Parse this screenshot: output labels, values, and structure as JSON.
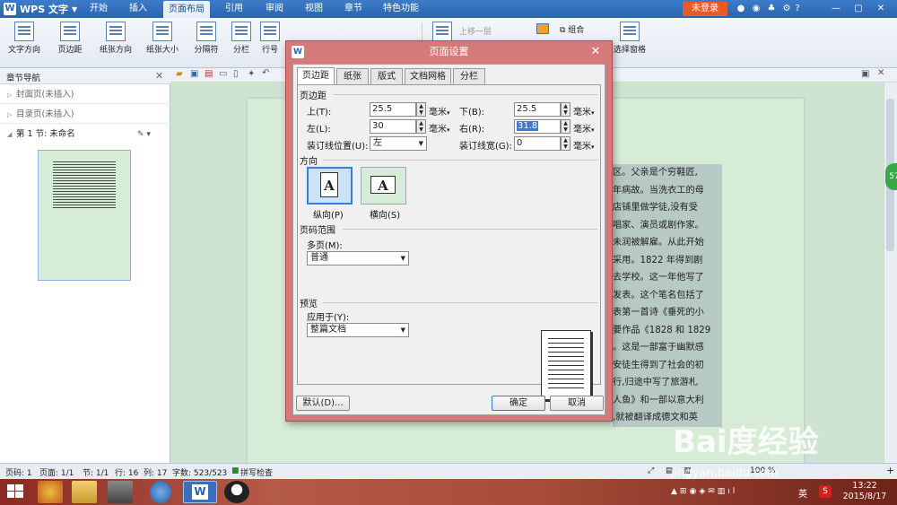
{
  "app": {
    "logo": "WPS 文字",
    "logo_letter": "W",
    "login": "未登录",
    "help": "?"
  },
  "menu": [
    "开始",
    "插入",
    "页面布局",
    "引用",
    "审阅",
    "视图",
    "章节",
    "特色功能"
  ],
  "ribbon": {
    "buttons": [
      "文字方向",
      "页边距",
      "纸张方向",
      "纸张大小",
      "分隔符",
      "分栏",
      "行号"
    ],
    "right": {
      "up_one": "上移一层",
      "group": "组合",
      "select_pane": "选择窗格"
    }
  },
  "nav": {
    "title": "章节导航",
    "items": [
      "封面页(未插入)",
      "目录页(未插入)"
    ],
    "section": "第 1 节: 未命名"
  },
  "doc_lines": [
    "区。父亲是个穷鞋匠,",
    "年病故。当洗衣工的母",
    "店铺里做学徒,没有受",
    "唱家、演员或剧作家。",
    "未润被解雇。从此开始",
    "采用。1822 年得到剧",
    "去学校。这一年他写了",
    "发表。这个笔名包括了",
    "表第一首诗《垂死的小",
    "要作品《1828 和 1829",
    "。这是一部富于幽默感",
    "安徒生得到了社会的初",
    "行,归途中写了旅游札",
    "人鱼》和一部以意大利",
    ",就被翻译成德文和英"
  ],
  "badge": "57",
  "dialog": {
    "title": "页面设置",
    "icon_letter": "W",
    "close": "✕",
    "tabs": [
      "页边距",
      "纸张",
      "版式",
      "文档网格",
      "分栏"
    ],
    "margins": {
      "label": "页边距",
      "top_label": "上(T):",
      "top_value": "25.5",
      "bottom_label": "下(B):",
      "bottom_value": "25.5",
      "left_label": "左(L):",
      "left_value": "30",
      "right_label": "右(R):",
      "right_value": "31.8",
      "gutter_pos_label": "装订线位置(U):",
      "gutter_pos_value": "左",
      "gutter_width_label": "装订线宽(G):",
      "gutter_width_value": "0",
      "unit": "毫米"
    },
    "orientation": {
      "label": "方向",
      "portrait": "纵向(P)",
      "landscape": "横向(S)",
      "letter": "A"
    },
    "pages": {
      "label": "页码范围",
      "multi_label": "多页(M):",
      "multi_value": "普通"
    },
    "preview": {
      "label": "预览",
      "apply_label": "应用于(Y):",
      "apply_value": "整篇文档"
    },
    "buttons": {
      "default": "默认(D)...",
      "ok": "确定",
      "cancel": "取消"
    }
  },
  "status": {
    "page_code": "页码: 1",
    "pages": "页面: 1/1",
    "section": "节: 1/1",
    "line": "行: 16",
    "column": "列: 17",
    "words": "字数: 523/523",
    "spell": "拼写检查",
    "zoom": "100 %"
  },
  "taskbar": {
    "time": "13:22",
    "date": "2015/8/17",
    "ime": "英"
  },
  "watermark": {
    "logo": "Bai度经验",
    "url": "jingyan.baidu.com"
  }
}
